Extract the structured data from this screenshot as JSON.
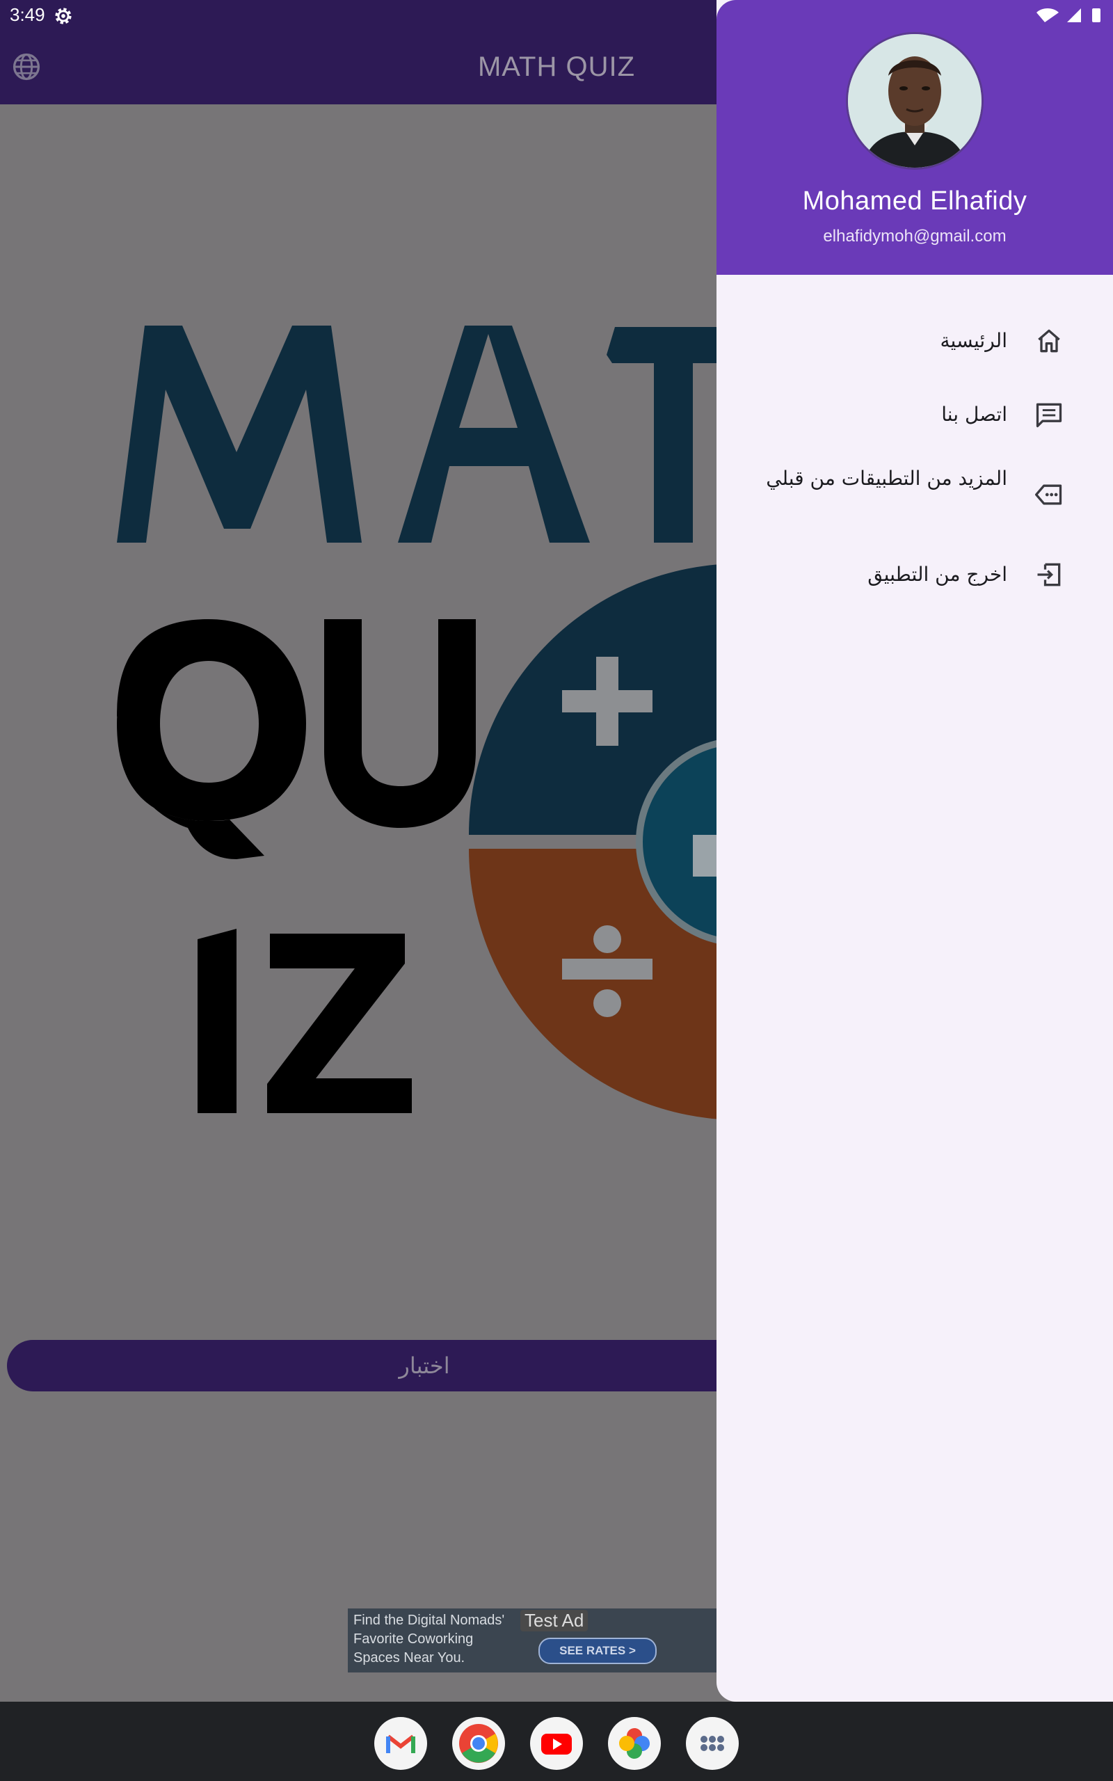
{
  "status_bar": {
    "time": "3:49"
  },
  "app_bar": {
    "title": "MATH QUIZ"
  },
  "main": {
    "quiz_button_label": "اختبار"
  },
  "ad": {
    "text": "Find the Digital Nomads' Favorite Coworking Spaces Near You.",
    "badge": "Test Ad",
    "cta": "SEE RATES >"
  },
  "drawer": {
    "user_name": "Mohamed Elhafidy",
    "user_email": "elhafidymoh@gmail.com",
    "items": [
      {
        "label": "الرئيسية",
        "icon": "home-icon"
      },
      {
        "label": "اتصل بنا",
        "icon": "message-icon"
      },
      {
        "label": "المزيد من التطبيقات من قبلي",
        "icon": "more-label-icon"
      },
      {
        "label": "اخرج من التطبيق",
        "icon": "logout-icon"
      }
    ]
  },
  "dock": [
    "gmail-icon",
    "chrome-icon",
    "youtube-icon",
    "photos-icon",
    "apps-grid-icon"
  ],
  "colors": {
    "app_bar": "#2d1a55",
    "drawer_header": "#6a3ab8",
    "drawer_bg": "#f6f1fa"
  }
}
